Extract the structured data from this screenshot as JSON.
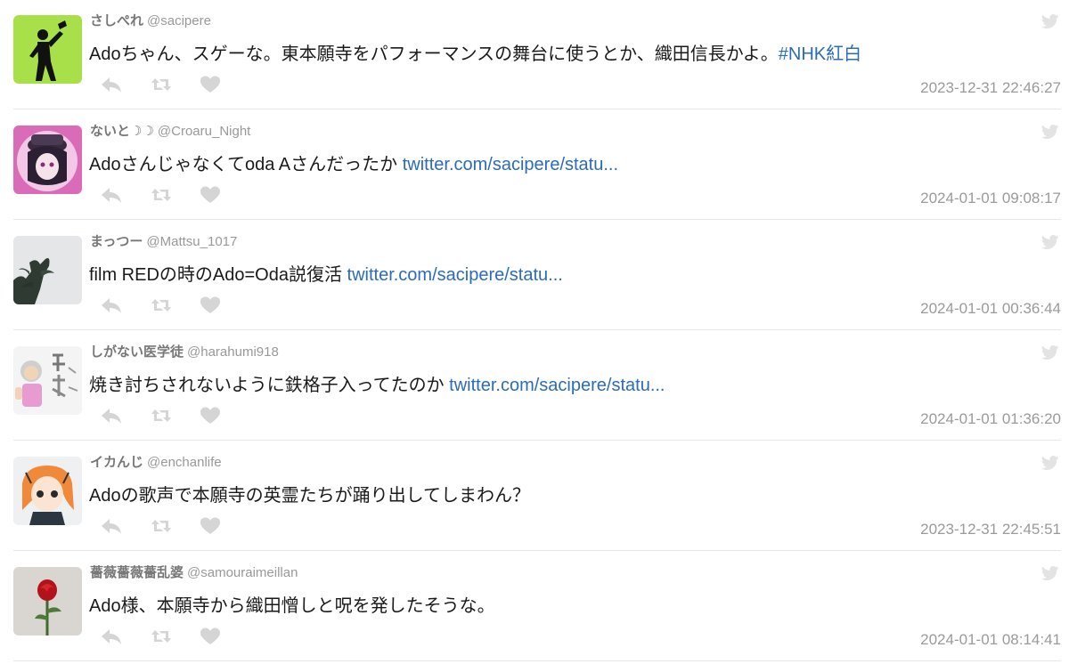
{
  "tweets": [
    {
      "name": "さしぺれ",
      "handle": "@sacipere",
      "text": "Adoちゃん、スゲーな。東本願寺をパフォーマンスの舞台に使うとか、織田信長かよ。",
      "link": "#NHK紅白",
      "timestamp": "2023-12-31 22:46:27",
      "avatar": "silhouette-avatar"
    },
    {
      "name": "ないと☽☽",
      "handle": "@Croaru_Night",
      "text": "Adoさんじゃなくてoda Aさんだったか ",
      "link": "twitter.com/sacipere/statu...",
      "timestamp": "2024-01-01 09:08:17",
      "avatar": "anime-hat-avatar"
    },
    {
      "name": "まっつー",
      "handle": "@Mattsu_1017",
      "text": "film REDの時のAdo=Oda説復活 ",
      "link": "twitter.com/sacipere/statu...",
      "timestamp": "2024-01-01 00:36:44",
      "avatar": "pine-tree-avatar"
    },
    {
      "name": "しがない医学徒",
      "handle": "@harahumi918",
      "text": "焼き討ちされないように鉄格子入ってたのか ",
      "link": "twitter.com/sacipere/statu...",
      "timestamp": "2024-01-01 01:36:20",
      "avatar": "illustration-avatar"
    },
    {
      "name": "イカんじ",
      "handle": "@enchanlife",
      "text": "Adoの歌声で本願寺の英霊たちが踊り出してしまわん？",
      "link": "",
      "timestamp": "2023-12-31 22:45:51",
      "avatar": "squid-girl-avatar"
    },
    {
      "name": "薔薇薔薇薔乱婆",
      "handle": "@samouraimeillan",
      "text": "Ado様、本願寺から織田憎しと呪を発したそうな。",
      "link": "",
      "timestamp": "2024-01-01 08:14:41",
      "avatar": "rose-avatar"
    }
  ],
  "icons": {
    "reply": "reply-icon",
    "retweet": "retweet-icon",
    "like": "heart-icon",
    "brand": "twitter-bird-icon"
  },
  "colors": {
    "link": "#2b6cb8",
    "muted": "#9a9a9a",
    "icon": "#d5d5d5"
  }
}
